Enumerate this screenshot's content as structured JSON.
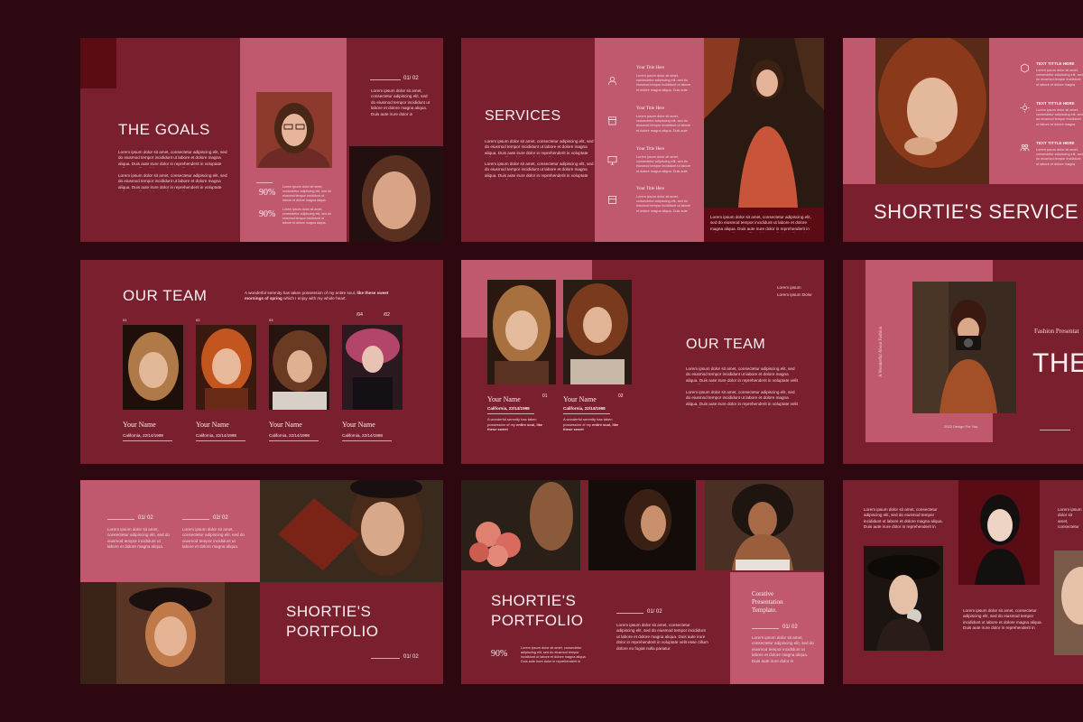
{
  "colors": {
    "background": "#2e0810",
    "slide": "#7a1f2e",
    "pink": "#c0596e",
    "dark": "#5a1020",
    "text": "#fbeff1"
  },
  "slide1": {
    "title": "THE GOALS",
    "page": "01/ 02",
    "pct1": "90%",
    "pct2": "90%",
    "photo1": "woman-with-glasses-photo",
    "photo2": "woman-portrait-photo"
  },
  "slide2": {
    "title": "SERVICES",
    "items": [
      {
        "title": "Your Title Here",
        "icon": "user-icon"
      },
      {
        "title": "Your Title Here",
        "icon": "store-icon"
      },
      {
        "title": "Your Title Here",
        "icon": "monitor-icon"
      },
      {
        "title": "Your Title Here",
        "icon": "box-icon"
      }
    ],
    "photo": "woman-with-glasses-orange-dress-photo"
  },
  "slide3": {
    "title": "SHORTIE'S SERVICE",
    "items": [
      {
        "title": "TEXT TITTLE HERE",
        "icon": "cube-icon"
      },
      {
        "title": "TEXT TITTLE HERE",
        "icon": "sun-icon"
      },
      {
        "title": "TEXT TITTLE HERE",
        "icon": "people-icon"
      }
    ],
    "photo": "curly-hair-woman-photo"
  },
  "slide4": {
    "title": "OUR TEAM",
    "intro_lead": "A wonderful serenity has taken possession of my entire soul,",
    "intro_bold": "like these sweet mornings of spring",
    "intro_tail": "which I enjoy with my whole heart.",
    "members": [
      {
        "number": "01",
        "name": "Your Name",
        "location": "California, 22/14/1998"
      },
      {
        "number": "02",
        "name": "Your Name",
        "location": "California, 22/14/1998"
      },
      {
        "number": "03",
        "name": "Your Name",
        "location": "California, 22/14/1998"
      },
      {
        "number": "/04",
        "name": "Your Name",
        "location": "California, 22/14/1998"
      }
    ],
    "extra_number": "/02"
  },
  "slide5": {
    "title": "OUR TEAM",
    "top_right_1": "Lorem ipsum",
    "top_right_2": "Lorem ipsum Dolor",
    "members": [
      {
        "number": "01",
        "name": "Your Name",
        "location": "California, 22/14/1998",
        "desc": "A wonderful serenity has taken possession of my",
        "desc_bold": "entire soul, like these sweet"
      },
      {
        "number": "02",
        "name": "Your Name",
        "location": "California, 22/14/1998",
        "desc": "A wonderful serenity has taken possession of my",
        "desc_bold": "entire soul, like these sweet"
      }
    ]
  },
  "slide6": {
    "title": "THE",
    "subtitle": "Fashion Presentat",
    "vertical": "A Wonderful About Fashion",
    "caption": "2022 Design For You",
    "photo": "woman-with-camera-photo"
  },
  "slide7": {
    "title_line1": "SHORTIE'S",
    "title_line2": "PORTFOLIO",
    "page1": "01/ 02",
    "page2": "02/ 02",
    "footer_page": "01/ 02",
    "photo1": "woman-with-leaf-photo",
    "photo2": "woman-with-hat-photo"
  },
  "slide8": {
    "title_line1": "SHORTIE'S",
    "title_line2": "PORTFOLIO",
    "side_text_1": "Corative",
    "side_text_2": "Presentation",
    "side_text_3": "Template.",
    "page1": "01/ 02",
    "page2": "01/ 02",
    "pct": "90%"
  },
  "slide9": {
    "photo1": "woman-in-red-photo",
    "photo2": "woman-with-hat-and-flower-photo",
    "photo3": "woman-portrait-edge-photo"
  },
  "lorem": "Lorem ipsum dolor sit amet, consectetur adipiscing elit, sed do eiusmod tempor incididunt ut labore et dolore magna aliqua. Duis aute irure dolor in reprehenderit in voluptate velit esse cillum dolore eu fugiat nulla pariatur."
}
